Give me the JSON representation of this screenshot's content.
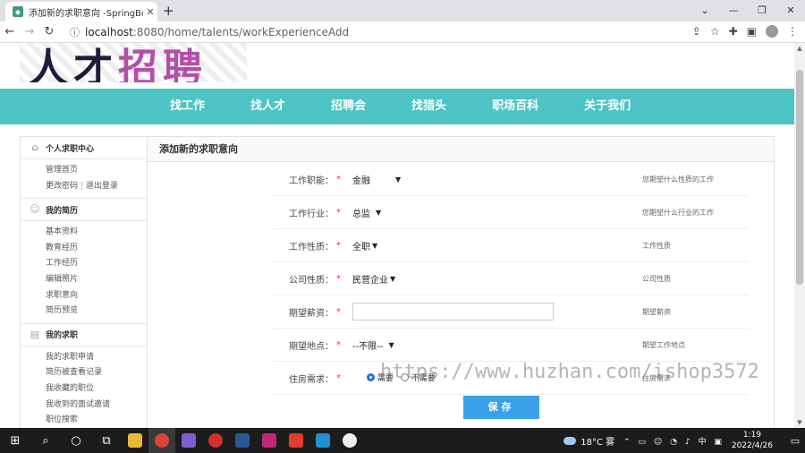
{
  "browser": {
    "tab_title": "添加新的求职意向 -SpringBoot...",
    "new_tab": "+",
    "url_host": "localhost",
    "url_rest": ":8080/home/talents/workExperienceAdd"
  },
  "nav": {
    "items": [
      "找工作",
      "找人才",
      "招聘会",
      "找猎头",
      "职场百科",
      "关于我们"
    ]
  },
  "sidebar": {
    "groups": [
      {
        "title": "个人求职中心",
        "icon": "home-icon",
        "links": [
          "管理首页",
          "更改密码",
          "退出登录"
        ]
      },
      {
        "title": "我的简历",
        "icon": "person-icon",
        "links": [
          "基本资料",
          "教育经历",
          "工作经历",
          "编辑照片",
          "求职意向",
          "简历预览"
        ]
      },
      {
        "title": "我的求职",
        "icon": "document-icon",
        "links": [
          "我的求职申请",
          "简历被查看记录",
          "我收藏的职位",
          "我收到的面试邀请",
          "职位搜索"
        ]
      }
    ],
    "separator": "|"
  },
  "form": {
    "title": "添加新的求职意向",
    "required_mark": "*",
    "rows": [
      {
        "label": "工作职能：",
        "value": "金融",
        "hint": "您期望什么性质的工作"
      },
      {
        "label": "工作行业：",
        "value": "总监",
        "hint": "您期望什么行业的工作"
      },
      {
        "label": "工作性质：",
        "value": "全职",
        "hint": "工作性质"
      },
      {
        "label": "公司性质：",
        "value": "民营企业",
        "hint": "公司性质"
      },
      {
        "label": "期望薪资：",
        "value": "",
        "hint": "期望薪资"
      },
      {
        "label": "期望地点：",
        "value": "--不限--",
        "hint": "期望工作地点"
      },
      {
        "label": "住房需求：",
        "value": "",
        "hint": "住房需求"
      }
    ],
    "housing_options": [
      "需要",
      "不需要"
    ],
    "housing_selected": "需要",
    "save_label": "保存"
  },
  "watermark": "https://www.huzhan.com/ishop3572",
  "taskbar": {
    "temperature": "18°C 雾",
    "ime": "中",
    "time": "1:19",
    "date": "2022/4/26"
  }
}
